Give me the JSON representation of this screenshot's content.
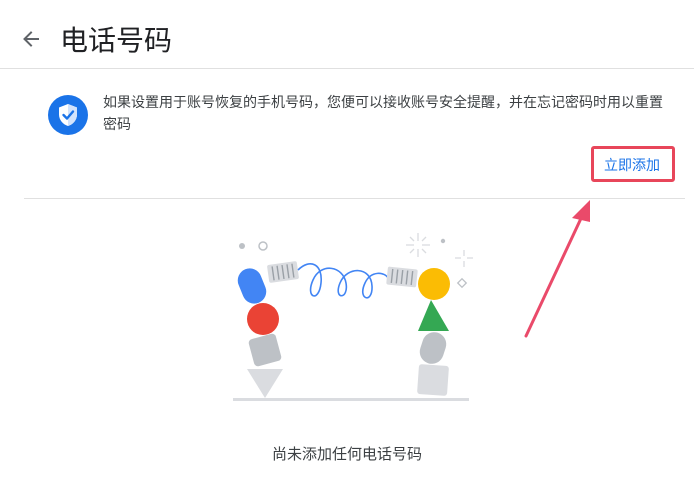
{
  "header": {
    "title": "电话号码",
    "back_icon": "arrow-left-icon"
  },
  "info": {
    "icon": "shield-check-icon",
    "text": "如果设置用于账号恢复的手机号码，您便可以接收账号安全提醒，并在忘记密码时用以重置密码",
    "accent_color": "#1a73e8"
  },
  "actions": {
    "add_label": "立即添加",
    "highlight_color": "#e8465a"
  },
  "empty_state": {
    "text": "尚未添加任何电话号码"
  }
}
